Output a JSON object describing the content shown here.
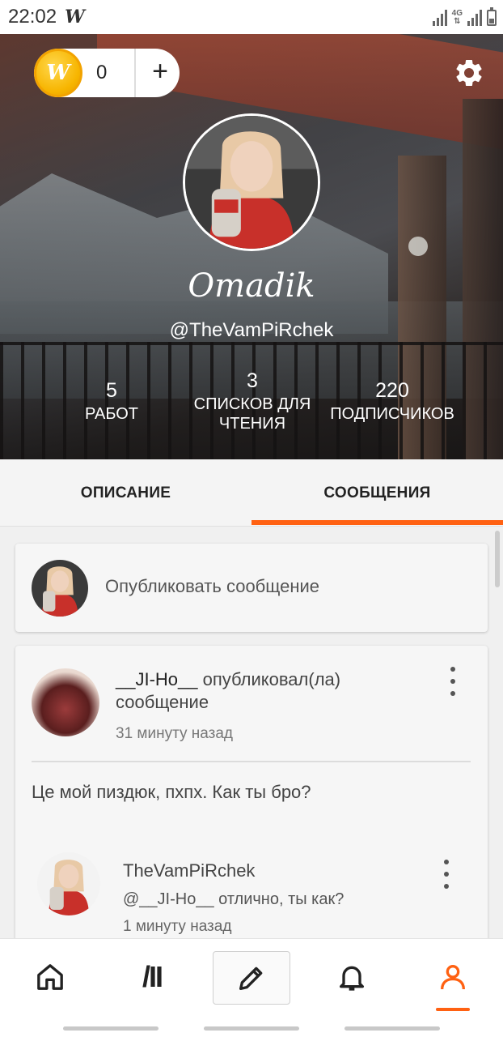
{
  "status_bar": {
    "time": "22:02",
    "app_icon": "W",
    "network_label": "4G"
  },
  "header": {
    "coins": {
      "icon_letter": "W",
      "count": "0",
      "add_label": "+"
    },
    "display_name": "Omadik",
    "handle": "@TheVamPiRchek",
    "stats": {
      "works": {
        "value": "5",
        "label": "РАБОТ"
      },
      "reading_lists": {
        "value": "3",
        "label_line1": "СПИСКОВ ДЛЯ",
        "label_line2": "ЧТЕНИЯ"
      },
      "followers": {
        "value": "220",
        "label": "ПОДПИСЧИКОВ"
      }
    }
  },
  "tabs": [
    {
      "label": "ОПИСАНИЕ",
      "active": false
    },
    {
      "label": "СООБЩЕНИЯ",
      "active": true
    }
  ],
  "post_box": {
    "placeholder": "Опубликовать сообщение"
  },
  "message": {
    "author": "__JI-Ho__",
    "action_line1": " опубликовал(ла)",
    "action_line2": "сообщение",
    "time": "31 минуту назад",
    "body": "Це мой пиздюк, пхпх. Как ты бро?",
    "reply": {
      "author": "TheVamPiRchek",
      "text": "@__JI-Ho__  отлично, ты как?",
      "time": "1 минуту назад"
    }
  },
  "bottom_nav": {
    "browse_glyph": "/II",
    "items": [
      "home-icon",
      "browse-icon",
      "write-icon",
      "bell-icon",
      "profile-icon"
    ],
    "active_color": "#ff6112"
  },
  "colors": {
    "accent": "#ff6112",
    "coin": "#f7b500"
  }
}
